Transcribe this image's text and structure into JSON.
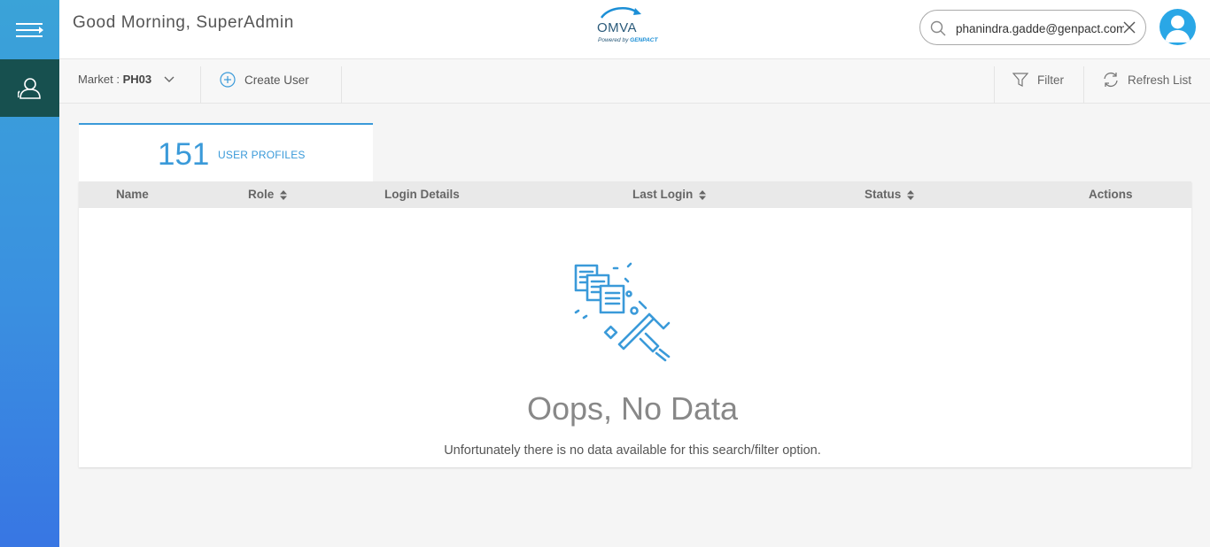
{
  "header": {
    "greeting": "Good Morning, SuperAdmin",
    "logo": {
      "name": "OMVA",
      "tagline_prefix": "Powered by",
      "tagline_brand": "GENPACT"
    }
  },
  "search": {
    "value": "phanindra.gadde@genpact.com",
    "icon": "search-icon",
    "clear_icon": "close-icon"
  },
  "sidebar": {
    "menu_icon": "hamburger-icon",
    "items": [
      {
        "icon": "users-icon",
        "active": true
      }
    ]
  },
  "toolbar": {
    "market_label": "Market : ",
    "market_value": "PH03",
    "create_user": "Create User",
    "filter": "Filter",
    "refresh": "Refresh List"
  },
  "tab": {
    "count": "151",
    "label": "USER PROFILES"
  },
  "table": {
    "columns": [
      {
        "label": "Name",
        "sortable": false
      },
      {
        "label": "Role",
        "sortable": true
      },
      {
        "label": "Login Details",
        "sortable": false
      },
      {
        "label": "Last Login",
        "sortable": true
      },
      {
        "label": "Status",
        "sortable": true
      },
      {
        "label": "Actions",
        "sortable": false
      }
    ],
    "rows": []
  },
  "empty_state": {
    "title": "Oops, No Data",
    "description": "Unfortunately there is no data available for this search/filter option."
  },
  "colors": {
    "accent": "#3a9ad9",
    "sidebar_active": "#17504f",
    "sidebar_gradient_top": "#3aa3d8",
    "sidebar_gradient_bottom": "#3876e3"
  }
}
